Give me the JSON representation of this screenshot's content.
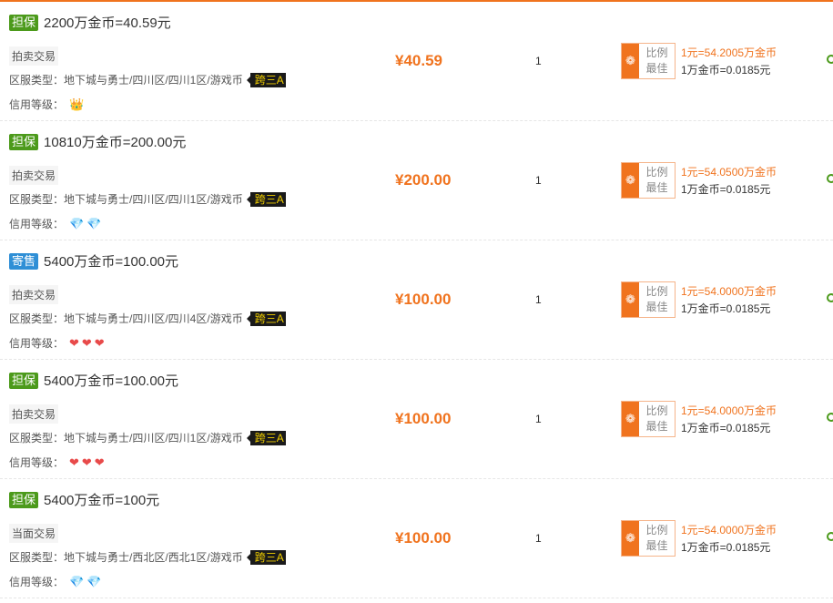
{
  "labels": {
    "server_prefix": "区服类型：",
    "credit_prefix": "信用等级：",
    "ratio_top": "比例",
    "ratio_bottom": "最佳"
  },
  "listings": [
    {
      "badge": "担保",
      "badge_color": "#4c9a1b",
      "title": "2200万金币=40.59元",
      "trade_type": "拍卖交易",
      "server": "地下城与勇士/四川区/四川1区/游戏币",
      "cross_tag": "跨三A",
      "credit_icons": "👑",
      "credit_icon_name": "crown-icon",
      "price": "¥40.59",
      "quantity": "1",
      "rate_yuan": "1元=54.2005万金币",
      "rate_gold": "1万金币=0.0185元"
    },
    {
      "badge": "担保",
      "badge_color": "#4c9a1b",
      "title": "10810万金币=200.00元",
      "trade_type": "拍卖交易",
      "server": "地下城与勇士/四川区/四川1区/游戏币",
      "cross_tag": "跨三A",
      "credit_icons": "💎💎",
      "credit_icon_name": "diamond-icon",
      "price": "¥200.00",
      "quantity": "1",
      "rate_yuan": "1元=54.0500万金币",
      "rate_gold": "1万金币=0.0185元"
    },
    {
      "badge": "寄售",
      "badge_color": "#2f8fd6",
      "title": "5400万金币=100.00元",
      "trade_type": "拍卖交易",
      "server": "地下城与勇士/四川区/四川4区/游戏币",
      "cross_tag": "跨三A",
      "credit_icons": "❤❤❤",
      "credit_icon_name": "heart-icon",
      "price": "¥100.00",
      "quantity": "1",
      "rate_yuan": "1元=54.0000万金币",
      "rate_gold": "1万金币=0.0185元"
    },
    {
      "badge": "担保",
      "badge_color": "#4c9a1b",
      "title": "5400万金币=100.00元",
      "trade_type": "拍卖交易",
      "server": "地下城与勇士/四川区/四川1区/游戏币",
      "cross_tag": "跨三A",
      "credit_icons": "❤❤❤",
      "credit_icon_name": "heart-icon",
      "price": "¥100.00",
      "quantity": "1",
      "rate_yuan": "1元=54.0000万金币",
      "rate_gold": "1万金币=0.0185元"
    },
    {
      "badge": "担保",
      "badge_color": "#4c9a1b",
      "title": "5400万金币=100元",
      "trade_type": "当面交易",
      "server": "地下城与勇士/西北区/西北1区/游戏币",
      "cross_tag": "跨三A",
      "credit_icons": "💎💎",
      "credit_icon_name": "diamond-icon",
      "price": "¥100.00",
      "quantity": "1",
      "rate_yuan": "1元=54.0000万金币",
      "rate_gold": "1万金币=0.0185元"
    }
  ]
}
